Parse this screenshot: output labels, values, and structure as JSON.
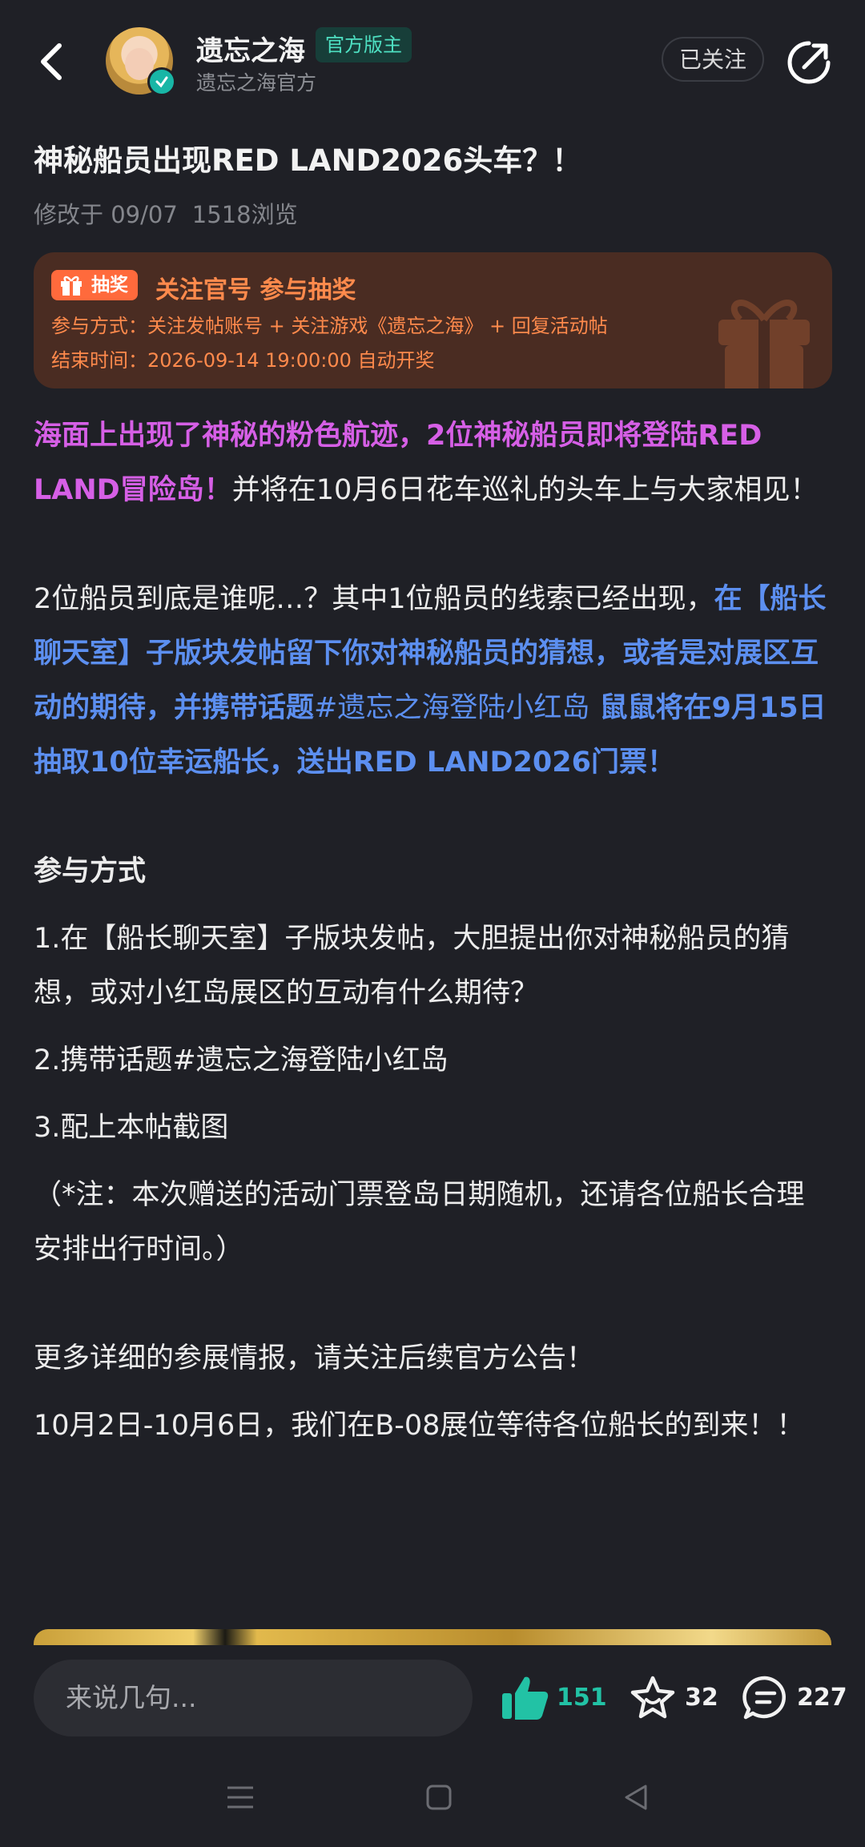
{
  "header": {
    "author_name": "遗忘之海",
    "author_tag": "官方版主",
    "author_sub": "遗忘之海官方",
    "follow_label": "已关注",
    "icons": [
      "back-icon",
      "share-icon"
    ]
  },
  "post": {
    "title": "神秘船员出现RED LAND2026头车？！",
    "modified": "修改于 09/07",
    "views": "1518浏览"
  },
  "lottery": {
    "chip_label": "抽奖",
    "headline": "关注官号 参与抽奖",
    "method": "参与方式：关注发帖账号 + 关注游戏《遗忘之海》 + 回复活动帖",
    "end_time": "结束时间：2026-09-14 19:00:00 自动开奖",
    "accent_color": "#ff8a4c"
  },
  "content": {
    "p1_pink": "海面上出现了神秘的粉色航迹，2位神秘船员即将登陆RED LAND冒险岛！",
    "p1_rest": "并将在10月6日花车巡礼的头车上与大家相见！",
    "p2_lead": "2位船员到底是谁呢…？其中1位船员的线索已经出现，",
    "p2_blue1": "在【船长聊天室】子版块发帖留下你对神秘船员的猜想，或者是对展区互动的期待，并携带话题",
    "p2_topic": "#遗忘之海登陆小红岛",
    "p2_blue2": " 鼠鼠将在9月15日抽取10位幸运船长，送出RED LAND2026门票！",
    "how_title": "参与方式",
    "step1": "1.在【船长聊天室】子版块发帖，大胆提出你对神秘船员的猜想，或对小红岛展区的互动有什么期待？",
    "step2": "2.携带话题#遗忘之海登陆小红岛",
    "step3": "3.配上本帖截图",
    "note": "（*注：本次赠送的活动门票登岛日期随机，还请各位船长合理安排出行时间。）",
    "more": "更多详细的参展情报，请关注后续官方公告！",
    "date_line": "10月2日-10月6日，我们在B-08展位等待各位船长的到来！！"
  },
  "bottom": {
    "input_placeholder": "来说几句...",
    "likes": "151",
    "favorites": "32",
    "comments": "227"
  },
  "colors": {
    "background": "#1f2026",
    "pink": "#d65fe6",
    "blue": "#5c8ff0",
    "teal": "#22c2a5"
  }
}
